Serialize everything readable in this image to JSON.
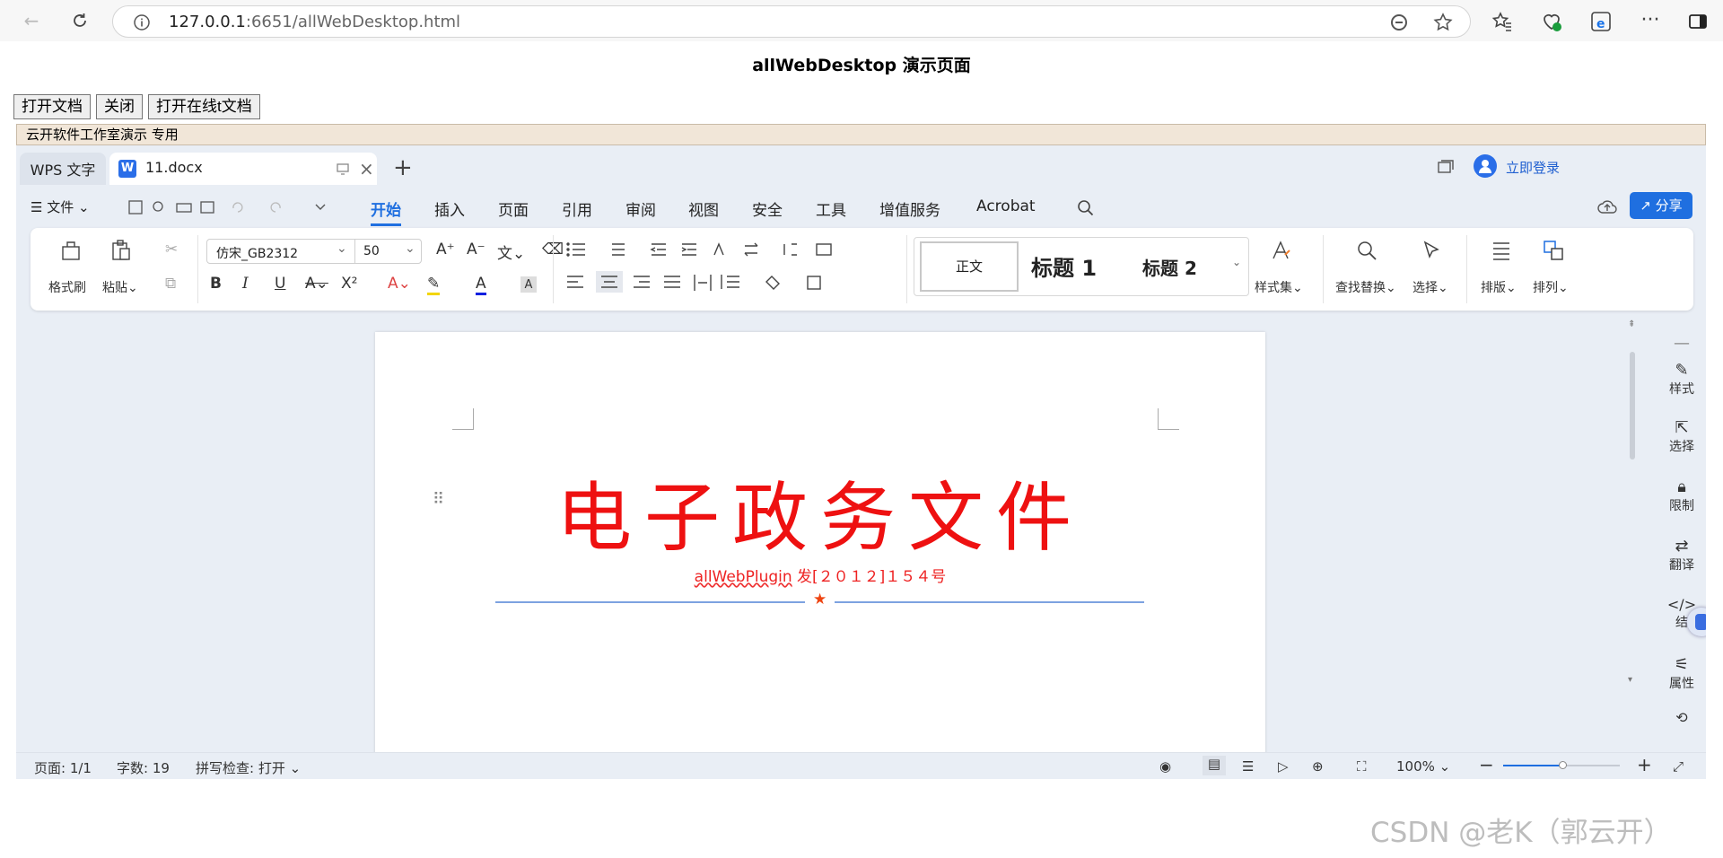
{
  "browser": {
    "url_host": "127.0.0.1",
    "url_path": ":6651/allWebDesktop.html"
  },
  "page": {
    "title": "allWebDesktop 演示页面",
    "buttons": [
      "打开文档",
      "关闭",
      "打开在线t文档"
    ],
    "notice": "云开软件工作室演示  专用"
  },
  "wps": {
    "app_tab": "WPS 文字",
    "doc_tab": "11.docx",
    "login": "立即登录",
    "file_menu": "文件",
    "menu": [
      "开始",
      "插入",
      "页面",
      "引用",
      "审阅",
      "视图",
      "安全",
      "工具",
      "增值服务",
      "Acrobat"
    ],
    "share": "分享",
    "ribbon": {
      "format_painter": "格式刷",
      "paste": "粘贴",
      "font_name": "仿宋_GB2312",
      "font_size": "50",
      "bold": "B",
      "italic": "I",
      "underline": "U",
      "superscript": "X²",
      "styles": [
        "正文",
        "标题  1",
        "标题  2"
      ],
      "style_set": "样式集",
      "find_replace": "查找替换",
      "select": "选择",
      "layout": "排版",
      "arrange": "排列"
    },
    "document": {
      "title": "电子政务文件",
      "number_prefix": "allWebPlugin",
      "number_rest": " 发[２０１２]１５４号"
    },
    "right_sidebar": [
      "样式",
      "选择",
      "限制",
      "翻译",
      "结",
      "属性"
    ],
    "status": {
      "page": "页面: 1/1",
      "words": "字数: 19",
      "spell": "拼写检查: 打开",
      "zoom": "100%"
    }
  },
  "watermark": "CSDN @老K（郭云开）",
  "colors": {
    "accent": "#1f6fe0",
    "doc_red": "#ee1111"
  }
}
